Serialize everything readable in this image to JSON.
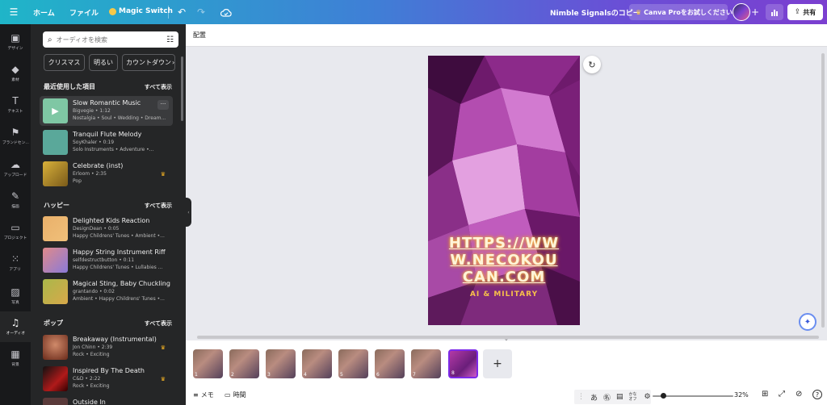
{
  "topbar": {
    "menu_icon": "hamburger-icon",
    "home": "ホーム",
    "file": "ファイル",
    "magic_switch": "Magic Switch",
    "design_name": "Nimble Signalsのコピー",
    "pro_button": "Canva Proをお試しください",
    "share": "共有"
  },
  "sidebar": {
    "items": [
      {
        "label": "デザイン",
        "icon": "layout-icon"
      },
      {
        "label": "素材",
        "icon": "shapes-icon"
      },
      {
        "label": "テキスト",
        "icon": "text-icon"
      },
      {
        "label": "ブランドセン...",
        "icon": "brand-icon"
      },
      {
        "label": "アップロード",
        "icon": "upload-icon"
      },
      {
        "label": "描画",
        "icon": "draw-icon"
      },
      {
        "label": "プロジェクト",
        "icon": "folder-icon"
      },
      {
        "label": "アプリ",
        "icon": "apps-icon"
      },
      {
        "label": "写真",
        "icon": "photo-icon"
      },
      {
        "label": "オーディオ",
        "icon": "audio-icon"
      },
      {
        "label": "背景",
        "icon": "background-icon"
      }
    ]
  },
  "panel": {
    "search_placeholder": "オーディオを検索",
    "chips": [
      "クリスマス",
      "明るい",
      "カウントダウン"
    ],
    "see_all": "すべて表示",
    "sections": [
      {
        "title": "最近使用した項目",
        "tracks": [
          {
            "title": "Slow Romantic Music",
            "meta": "Bigvegie • 1:12",
            "tags": "Nostalgia • Soul • Wedding • Dream...",
            "thumb": "#7fc7a4",
            "premium": false
          },
          {
            "title": "Tranquil Flute Melody",
            "meta": "SoyKhaler • 0:19",
            "tags": "Solo Instruments • Adventure •...",
            "thumb": "#5aa89a",
            "premium": false
          },
          {
            "title": "Celebrate (inst)",
            "meta": "Erloom • 2:35",
            "tags": "Pop",
            "thumb": "#d9b13a",
            "premium": true
          }
        ]
      },
      {
        "title": "ハッピー",
        "tracks": [
          {
            "title": "Delighted Kids Reaction",
            "meta": "DesignDean • 0:05",
            "tags": "Happy Childrens' Tunes • Ambient •...",
            "thumb": "#e9b06a",
            "premium": false
          },
          {
            "title": "Happy String Instrument Riff",
            "meta": "selfdestructbutton • 0:11",
            "tags": "Happy Childrens' Tunes • Lullabies ...",
            "thumb": "#b07ad0",
            "premium": false
          },
          {
            "title": "Magical Sting, Baby Chuckling",
            "meta": "grantando • 0:02",
            "tags": "Ambient • Happy Childrens' Tunes •...",
            "thumb": "#a9b84a",
            "premium": false
          }
        ]
      },
      {
        "title": "ポップ",
        "tracks": [
          {
            "title": "Breakaway (Instrumental)",
            "meta": "Jon Chinn • 2:39",
            "tags": "Rock • Exciting",
            "thumb": "#b5603c",
            "premium": true
          },
          {
            "title": "Inspired By The Death",
            "meta": "C&D • 2:22",
            "tags": "Rock • Exciting",
            "thumb": "#8a1a1a",
            "premium": true
          },
          {
            "title": "Outside In",
            "meta": "",
            "tags": "",
            "thumb": "#5a3a3a",
            "premium": false
          }
        ]
      }
    ]
  },
  "canvas": {
    "position_label": "配置",
    "design_text_1": "HTTPS://WW",
    "design_text_2": "W.NECOKOU",
    "design_text_3": "CAN.COM",
    "design_subtext": "AI & MILITARY"
  },
  "pages": {
    "count": 8,
    "selected": 8
  },
  "footer": {
    "notes": "メモ",
    "timer": "時間",
    "kana": "あ",
    "kana_toggle": "かな オフ",
    "zoom": "32%"
  }
}
